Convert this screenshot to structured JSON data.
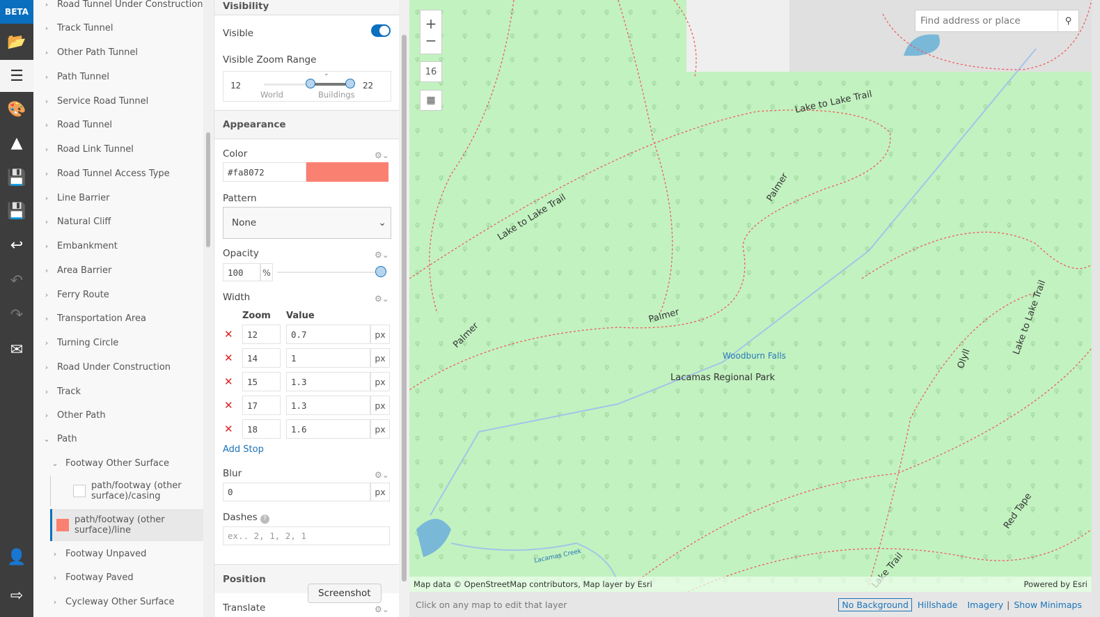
{
  "nav": {
    "beta": "BETA",
    "items": [
      "folder-icon",
      "layers-icon",
      "palette-icon",
      "shapes-icon",
      "save-icon",
      "save-as-icon",
      "revert-icon",
      "undo-icon",
      "redo-icon",
      "mail-icon",
      "account-icon",
      "export-icon"
    ]
  },
  "layers": {
    "items": [
      "Road Tunnel Under Construction",
      "Track Tunnel",
      "Other Path Tunnel",
      "Path Tunnel",
      "Service Road Tunnel",
      "Road Tunnel",
      "Road Link Tunnel",
      "Road Tunnel Access Type",
      "Line Barrier",
      "Natural Cliff",
      "Embankment",
      "Area Barrier",
      "Ferry Route",
      "Transportation Area",
      "Turning Circle",
      "Road Under Construction",
      "Track",
      "Other Path"
    ],
    "path": "Path",
    "footway_other": "Footway Other Surface",
    "casing": "path/footway (other surface)/casing",
    "line": "path/footway (other surface)/line",
    "after": [
      "Footway Unpaved",
      "Footway Paved",
      "Cycleway Other Surface"
    ]
  },
  "panel": {
    "visibility": "Visibility",
    "visible": "Visible",
    "visible_on": true,
    "zoom_range": "Visible Zoom Range",
    "zoom_min": "12",
    "zoom_max": "22",
    "world": "World",
    "buildings": "Buildings",
    "appearance": "Appearance",
    "color_label": "Color",
    "color": "#fa8072",
    "pattern_label": "Pattern",
    "pattern": "None",
    "opacity_label": "Opacity",
    "opacity": "100",
    "pct": "%",
    "width_label": "Width",
    "zoom_col": "Zoom",
    "value_col": "Value",
    "unit": "px",
    "stops": [
      {
        "zoom": "12",
        "value": "0.7"
      },
      {
        "zoom": "14",
        "value": "1"
      },
      {
        "zoom": "15",
        "value": "1.3"
      },
      {
        "zoom": "17",
        "value": "1.3"
      },
      {
        "zoom": "18",
        "value": "1.6"
      }
    ],
    "add_stop": "Add Stop",
    "blur_label": "Blur",
    "blur": "0",
    "dashes_label": "Dashes",
    "dashes_placeholder": "ex.. 2, 1, 2, 1",
    "position": "Position",
    "translate": "Translate",
    "tooltip": "Screenshot"
  },
  "map": {
    "zoom": "16",
    "search_placeholder": "Find address or place",
    "labels": [
      "Lake to Lake Trail",
      "Lake to Lake Trail",
      "Palmer",
      "Palmer",
      "Palmer",
      "Woodburn Falls",
      "Lacamas Regional Park",
      "Lake to Lake Trail",
      "Olyll",
      "Red Tape",
      "Lake Trail",
      "Lacamas Creek"
    ],
    "attribution": "Map data © OpenStreetMap contributors, Map layer by Esri",
    "powered": "Powered by Esri"
  },
  "bottom": {
    "hint": "Click on any map to edit that layer",
    "links": [
      "No Background",
      "Hillshade",
      "Imagery",
      "Show Minimaps"
    ]
  }
}
